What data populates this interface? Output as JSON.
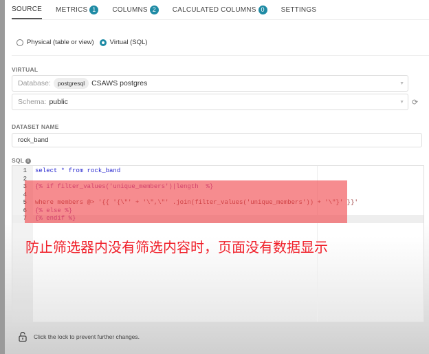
{
  "tabs": [
    {
      "label": "SOURCE"
    },
    {
      "label": "METRICS",
      "count": "1"
    },
    {
      "label": "COLUMNS",
      "count": "2"
    },
    {
      "label": "CALCULATED COLUMNS",
      "count": "0"
    },
    {
      "label": "SETTINGS"
    }
  ],
  "source_type": {
    "physical": "Physical (table or view)",
    "virtual": "Virtual (SQL)",
    "selected": "virtual"
  },
  "virtual": {
    "label": "VIRTUAL",
    "database_prefix": "Database:",
    "database_backend": "postgresql",
    "database_name": "CSAWS postgres",
    "schema_prefix": "Schema:",
    "schema_value": "public"
  },
  "dataset": {
    "label": "DATASET NAME",
    "value": "rock_band"
  },
  "sql": {
    "label": "SQL",
    "lines": [
      {
        "n": "1",
        "text": "select * from rock_band"
      },
      {
        "n": "2",
        "text": ""
      },
      {
        "n": "3",
        "text": "{% if filter_values('unique_members')|length  %}"
      },
      {
        "n": "4",
        "text": ""
      },
      {
        "n": "5",
        "text": "where members @> '{{ '{\\\"' + '\\\",\\\"' .join(filter_values('unique_members')) + '\\\"}' }}'"
      },
      {
        "n": "6",
        "text": "{% else %}"
      },
      {
        "n": "7",
        "text": "{% endif %}"
      }
    ]
  },
  "annotation": "防止筛选器内没有筛选内容时，页面没有数据显示",
  "footer": {
    "text": "Click the lock to prevent further changes."
  },
  "colors": {
    "accent": "#1f8ba5",
    "annotation": "#f0202a",
    "highlight": "#f0464b"
  }
}
